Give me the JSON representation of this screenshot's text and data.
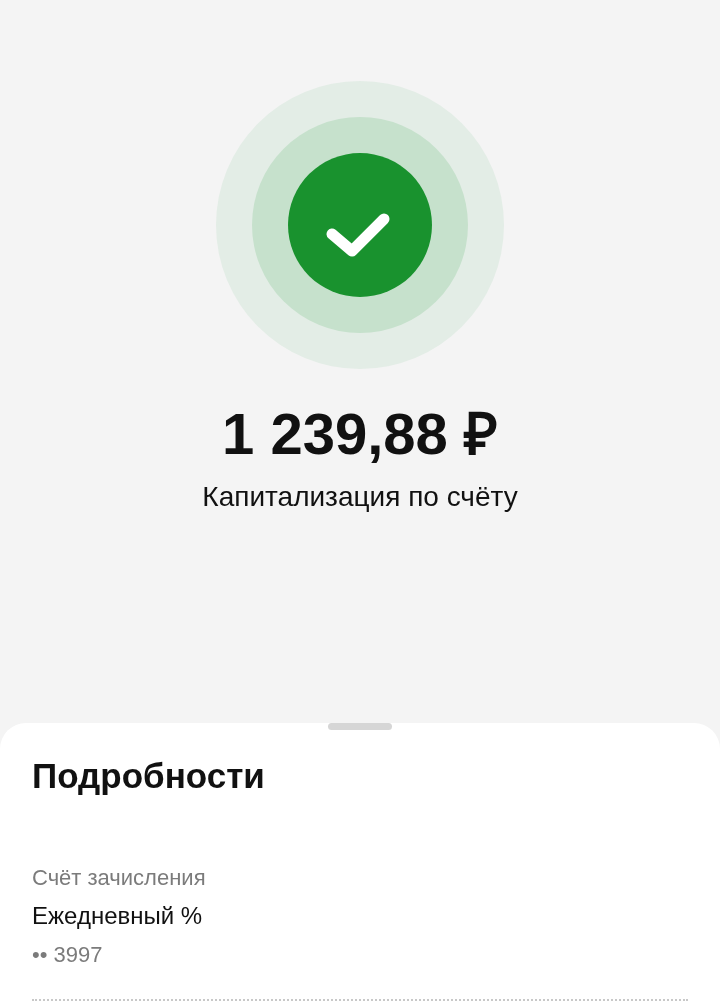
{
  "result": {
    "amount": "1 239,88 ₽",
    "subtitle": "Капитализация по счёту"
  },
  "details": {
    "title": "Подробности",
    "fields": [
      {
        "label": "Счёт зачисления",
        "value": "Ежедневный %",
        "account": "•• 3997"
      }
    ]
  }
}
